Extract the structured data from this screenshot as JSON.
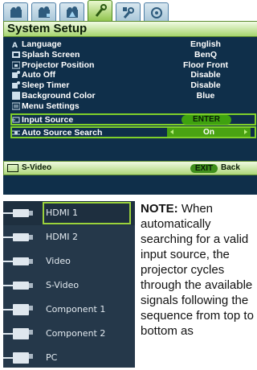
{
  "tabs": [
    {
      "icon": "picture-icon",
      "active": false
    },
    {
      "icon": "picture-advanced-icon",
      "active": false
    },
    {
      "icon": "display-icon",
      "active": false
    },
    {
      "icon": "system-setup-icon",
      "active": true
    },
    {
      "icon": "system-advanced-icon",
      "active": false
    },
    {
      "icon": "information-icon",
      "active": false
    }
  ],
  "title": "System Setup",
  "menu": {
    "rows": [
      {
        "label": "Language",
        "value": "English"
      },
      {
        "label": "Splash Screen",
        "value": "BenQ"
      },
      {
        "label": "Projector Position",
        "value": "Floor Front"
      },
      {
        "label": "Auto Off",
        "value": "Disable"
      },
      {
        "label": "Sleep Timer",
        "value": "Disable"
      },
      {
        "label": "Background Color",
        "value": "Blue"
      },
      {
        "label": "Menu Settings",
        "value": ""
      }
    ],
    "input_source": {
      "label": "Input Source",
      "value": "ENTER"
    },
    "auto_source_search": {
      "label": "Auto Source Search",
      "value": "On"
    }
  },
  "status": {
    "source": "S-Video",
    "exit": "EXIT",
    "back": "Back"
  },
  "sources": [
    {
      "name": "HDMI 1",
      "selected": true
    },
    {
      "name": "HDMI 2",
      "selected": false
    },
    {
      "name": "Video",
      "selected": false
    },
    {
      "name": "S-Video",
      "selected": false
    },
    {
      "name": "Component 1",
      "selected": false
    },
    {
      "name": "Component 2",
      "selected": false
    },
    {
      "name": "PC",
      "selected": false
    }
  ],
  "note": {
    "label": "NOTE:",
    "text": "When automatically searching for a valid input source, the projector cycles through the available signals following the sequence from top to bottom as"
  },
  "colors": {
    "menu_bg": "#0f2f4a",
    "accent": "#7fd02a",
    "tab_active": "#8ec24a",
    "list_bg": "#25384a"
  }
}
